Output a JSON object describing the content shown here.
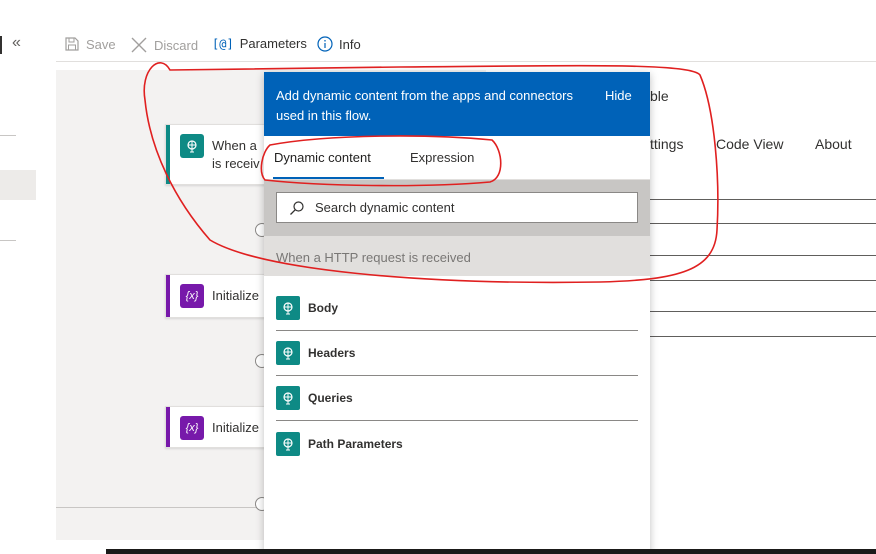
{
  "toolbar": {
    "collapse_glyph": "«",
    "save_label": "Save",
    "discard_label": "Discard",
    "parameters_label": "Parameters",
    "info_label": "Info",
    "parameters_icon_text": "[@]"
  },
  "canvas": {
    "cards": [
      {
        "title_line1": "When a",
        "title_line2": "is receiv",
        "accent": "#0e8a85"
      },
      {
        "title": "Initialize",
        "accent": "#7719aa"
      },
      {
        "title": "Initialize",
        "accent": "#7719aa"
      }
    ],
    "variable_icon_text": "{x}"
  },
  "right_panel": {
    "partial_text": "ble",
    "tabs": [
      "ttings",
      "Code View",
      "About"
    ]
  },
  "popup": {
    "description": "Add dynamic content from the apps and connectors used in this flow.",
    "hide_label": "Hide",
    "tabs": [
      {
        "label": "Dynamic content",
        "active": true
      },
      {
        "label": "Expression",
        "active": false
      }
    ],
    "search": {
      "placeholder": "Search dynamic content",
      "value": ""
    },
    "section_header": "When a HTTP request is received",
    "items": [
      {
        "label": "Body"
      },
      {
        "label": "Headers"
      },
      {
        "label": "Queries"
      },
      {
        "label": "Path Parameters"
      }
    ]
  },
  "colors": {
    "brand_blue": "#0062b8",
    "trigger_teal": "#0e8a85",
    "variable_purple": "#7719aa",
    "annotation_red": "#e02020"
  }
}
